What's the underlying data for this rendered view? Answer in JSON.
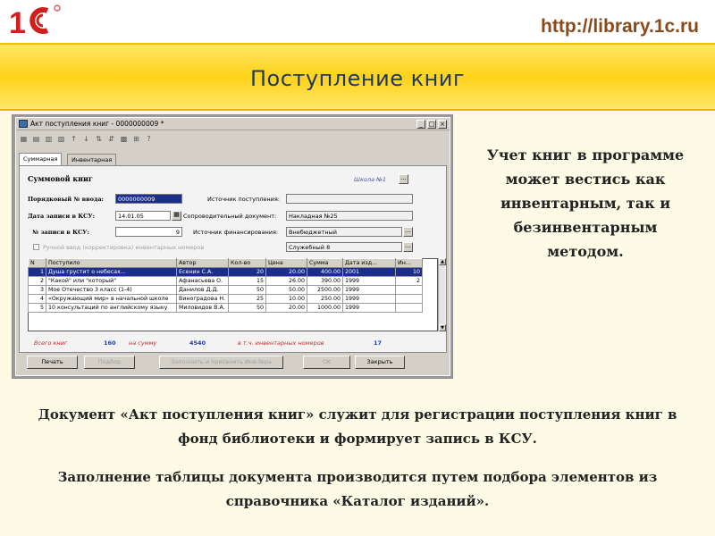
{
  "header": {
    "logo_text": "1С",
    "url": "http://library.1c.ru",
    "title": "Поступление книг"
  },
  "window": {
    "title": "Акт поступления книг - 0000000009 *",
    "tabs": [
      "Суммарная",
      "Инвентарная"
    ],
    "school_link": "Школа №1",
    "form_title": "Суммовой книг",
    "fields": {
      "serial_label": "Порядковый № ввода:",
      "serial_value": "0000000009",
      "date_label": "Дата записи в КСУ:",
      "date_value": "14.01.05",
      "ksu_label": "№ записи в КСУ:",
      "ksu_value": "9",
      "manual_label": "Ручной ввод (корректировка) инвентарных номеров",
      "source_label": "Источник поступления:",
      "source_value": "",
      "doc_label": "Сопроводительный документ:",
      "doc_value": "Накладная №25",
      "finance_label": "Источник финансирования:",
      "finance_value": "Внебюджетный",
      "finance2_value": "Служебный 8"
    },
    "table": {
      "columns": [
        "N",
        "Поступило",
        "Автор",
        "Кол-во",
        "Цена",
        "Сумма",
        "Дата изд...",
        "Ин..."
      ],
      "rows": [
        [
          "1",
          "Душа грустит о небесах...",
          "Есенин С.А.",
          "20",
          "20.00",
          "400.00",
          "2001",
          "10"
        ],
        [
          "2",
          "\"Какой\" или \"который\"",
          "Афанасьева О.",
          "15",
          "26.00",
          "390.00",
          "1999",
          "2"
        ],
        [
          "3",
          "Мое Отечество 3 класс (1-4)",
          "Данилов Д.Д.",
          "50",
          "50.00",
          "2500.00",
          "1999",
          ""
        ],
        [
          "4",
          "«Окружающий мир» в начальной школе",
          "Виноградова Н.",
          "25",
          "10.00",
          "250.00",
          "1999",
          ""
        ],
        [
          "5",
          "10 консультаций по английскому языку",
          "Миловидов В.А.",
          "50",
          "20.00",
          "1000.00",
          "1999",
          ""
        ]
      ]
    },
    "totals": {
      "books_label": "Всего книг",
      "books_value": "160",
      "sum_label": "на сумму",
      "sum_value": "4540",
      "inv_label": "в т.ч. инвентарных номеров",
      "inv_value": "17"
    },
    "buttons": {
      "print": "Печать",
      "pick": "Подбор",
      "fill_inv": "Заполнить и присвоить Инв.№ра",
      "ok": "OK",
      "close": "Закрыть"
    }
  },
  "side_text": "Учет книг в программе может вестись как инвентарным, так и безинвентарным методом.",
  "caption1": "Документ «Акт поступления книг» служит для регистрации поступления книг в фонд библиотеки и формирует запись в КСУ.",
  "caption2": "Заполнение таблицы документа производится путем подбора элементов из справочника «Каталог изданий».",
  "colors": {
    "band": "#ffd21a",
    "title": "#1f3a5c",
    "url": "#8a4a1a",
    "logo_red": "#d21e1e"
  }
}
